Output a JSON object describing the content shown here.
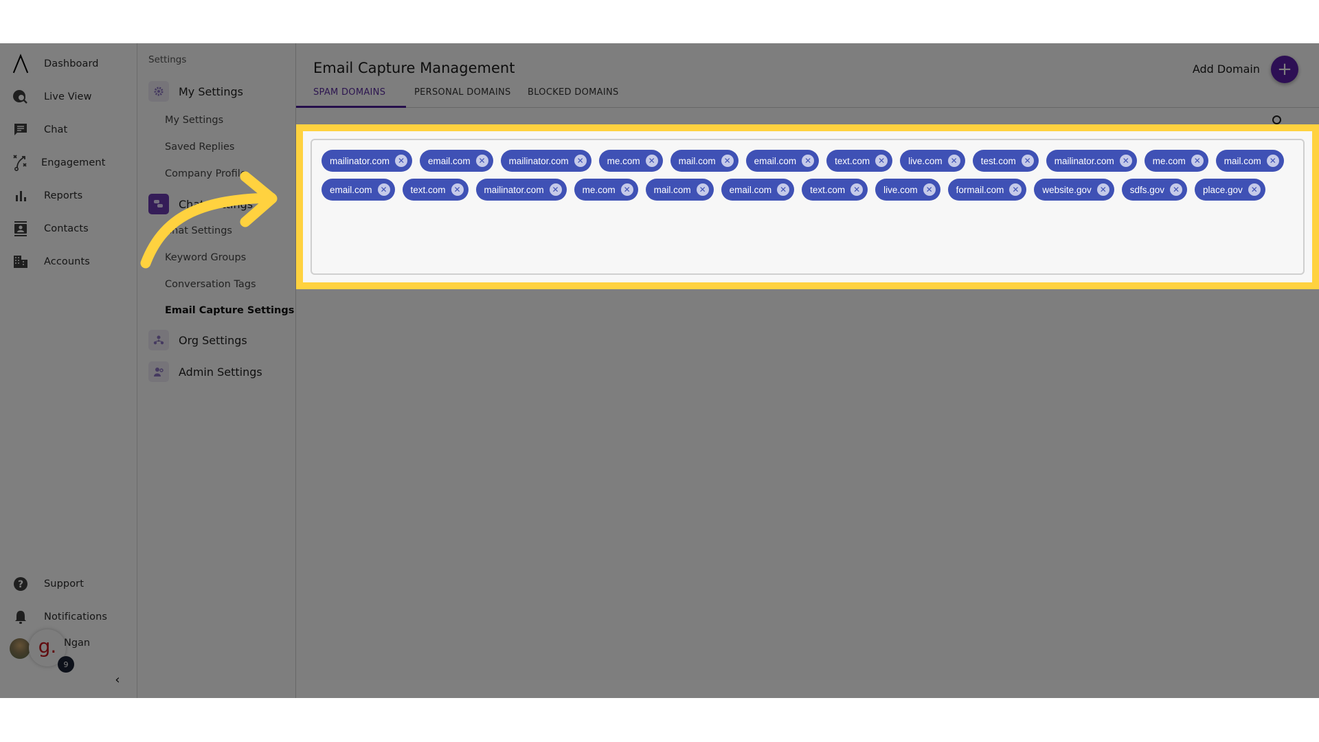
{
  "nav": {
    "items": [
      {
        "label": "Dashboard",
        "icon": "logo-icon"
      },
      {
        "label": "Live View",
        "icon": "live-view-icon"
      },
      {
        "label": "Chat",
        "icon": "chat-icon"
      },
      {
        "label": "Engagement",
        "icon": "engagement-icon"
      },
      {
        "label": "Reports",
        "icon": "bar-chart-icon"
      },
      {
        "label": "Contacts",
        "icon": "contacts-icon"
      },
      {
        "label": "Accounts",
        "icon": "building-icon"
      }
    ],
    "bottom": [
      {
        "label": "Support",
        "icon": "help-icon"
      },
      {
        "label": "Notifications",
        "icon": "bell-icon"
      }
    ],
    "user": {
      "name": "Ngan",
      "badge_letter": "g.",
      "notification_count": "9"
    },
    "collapse_glyph": "‹"
  },
  "settings": {
    "title": "Settings",
    "sections": [
      {
        "label": "My Settings",
        "items": [
          "My Settings",
          "Saved Replies",
          "Company Profile"
        ]
      },
      {
        "label": "Chat Settings",
        "items": [
          "Chat Settings",
          "Keyword Groups",
          "Conversation Tags",
          "Email Capture Settings"
        ]
      },
      {
        "label": "Org Settings",
        "items": []
      },
      {
        "label": "Admin Settings",
        "items": []
      }
    ],
    "active_item": "Email Capture Settings"
  },
  "main": {
    "title": "Email Capture Management",
    "tabs": [
      {
        "label": "SPAM DOMAINS",
        "active": true
      },
      {
        "label": "PERSONAL DOMAINS",
        "active": false
      },
      {
        "label": "BLOCKED DOMAINS",
        "active": false
      }
    ],
    "add_domain_label": "Add Domain",
    "add_glyph": "+",
    "remove_glyph": "✕",
    "domains": [
      "mailinator.com",
      "email.com",
      "mailinator.com",
      "me.com",
      "mail.com",
      "email.com",
      "text.com",
      "live.com",
      "test.com",
      "mailinator.com",
      "me.com",
      "mail.com",
      "email.com",
      "text.com",
      "mailinator.com",
      "me.com",
      "mail.com",
      "email.com",
      "text.com",
      "live.com",
      "formail.com",
      "website.gov",
      "sdfs.gov",
      "place.gov"
    ]
  },
  "colors": {
    "chip": "#3f51b5",
    "chip_remove": "#c5cae9",
    "accent": "#5a1fa8",
    "highlight": "#ffd23f"
  }
}
